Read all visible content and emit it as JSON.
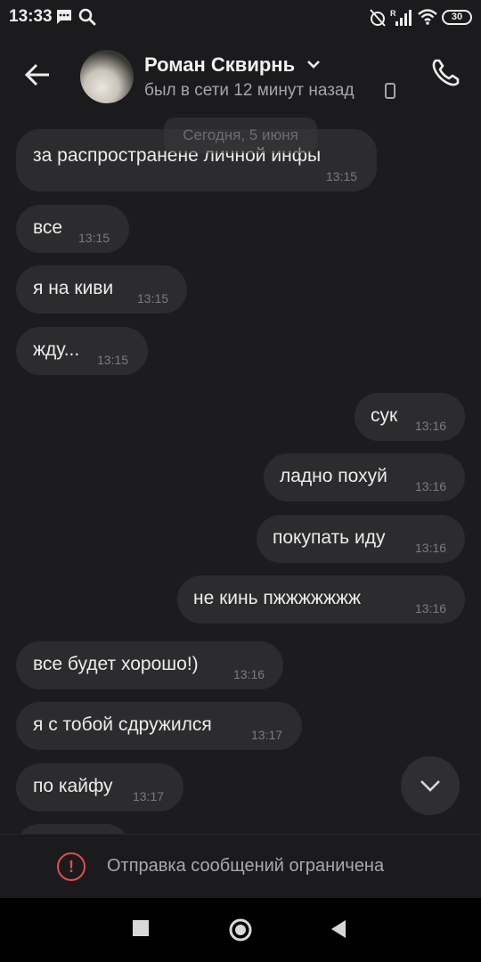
{
  "status_bar": {
    "time": "13:33",
    "battery": "30"
  },
  "header": {
    "contact_name": "Роман Сквирнь",
    "last_seen": "был в сети 12 минут назад"
  },
  "chat": {
    "date_separator": "Сегодня, 5 июня",
    "messages": [
      {
        "text": "за распространене личной инфы",
        "time": "13:15",
        "direction": "in"
      },
      {
        "text": "все",
        "time": "13:15",
        "direction": "in"
      },
      {
        "text": "я на киви",
        "time": "13:15",
        "direction": "in"
      },
      {
        "text": "жду...",
        "time": "13:15",
        "direction": "in"
      },
      {
        "text": "сук",
        "time": "13:16",
        "direction": "out"
      },
      {
        "text": "ладно похуй",
        "time": "13:16",
        "direction": "out"
      },
      {
        "text": "покупать иду",
        "time": "13:16",
        "direction": "out"
      },
      {
        "text": "не кинь пжжжжжжж",
        "time": "13:16",
        "direction": "out"
      },
      {
        "text": "все будет хорошо!)",
        "time": "13:16",
        "direction": "in"
      },
      {
        "text": "я с тобой сдружился",
        "time": "13:17",
        "direction": "in"
      },
      {
        "text": "по кайфу",
        "time": "13:17",
        "direction": "in"
      }
    ]
  },
  "restricted_notice": "Отправка сообщений ограничена",
  "colors": {
    "background": "#1c1c1e",
    "bubble": "#2c2c2e",
    "warning": "#e84a4a"
  }
}
